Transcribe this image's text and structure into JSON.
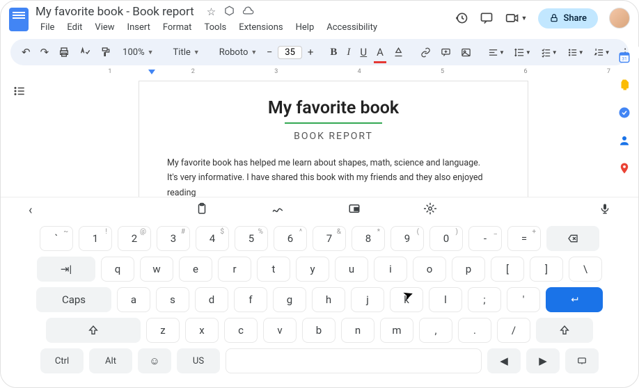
{
  "header": {
    "doc_title": "My favorite book - Book report",
    "menu": [
      "File",
      "Edit",
      "View",
      "Insert",
      "Format",
      "Tools",
      "Extensions",
      "Help",
      "Accessibility"
    ],
    "share_label": "Share"
  },
  "toolbar": {
    "zoom": "100%",
    "style": "Title",
    "font": "Roboto",
    "font_size": "35"
  },
  "ruler": {
    "marks": [
      "",
      "1",
      "2",
      "3",
      "4",
      "5",
      "6",
      "7"
    ]
  },
  "document": {
    "title": "My favorite book",
    "subtitle": "BOOK REPORT",
    "paragraph1": "My favorite book has helped me learn about shapes, math, science and language.",
    "paragraph2": "It's very informative. I have shared this book with my friends and they also enjoyed reading"
  },
  "keyboard": {
    "row1": [
      {
        "main": "`",
        "sup": "~"
      },
      {
        "main": "1",
        "sup": "!"
      },
      {
        "main": "2",
        "sup": "@"
      },
      {
        "main": "3",
        "sup": "#"
      },
      {
        "main": "4",
        "sup": "$"
      },
      {
        "main": "5",
        "sup": "%"
      },
      {
        "main": "6",
        "sup": "^"
      },
      {
        "main": "7",
        "sup": "&"
      },
      {
        "main": "8",
        "sup": "*"
      },
      {
        "main": "9",
        "sup": "("
      },
      {
        "main": "0",
        "sup": ")"
      },
      {
        "main": "-",
        "sup": "_"
      },
      {
        "main": "=",
        "sup": "+"
      }
    ],
    "row2": [
      "q",
      "w",
      "e",
      "r",
      "t",
      "y",
      "u",
      "i",
      "o",
      "p",
      "[",
      "]",
      "\\"
    ],
    "row3": [
      "a",
      "s",
      "d",
      "f",
      "g",
      "h",
      "j",
      "k",
      "l",
      ";",
      "'"
    ],
    "row4": [
      "z",
      "x",
      "c",
      "v",
      "b",
      "n",
      "m",
      ",",
      ".",
      "/"
    ],
    "caps": "Caps",
    "ctrl": "Ctrl",
    "alt": "Alt",
    "lang": "US"
  }
}
